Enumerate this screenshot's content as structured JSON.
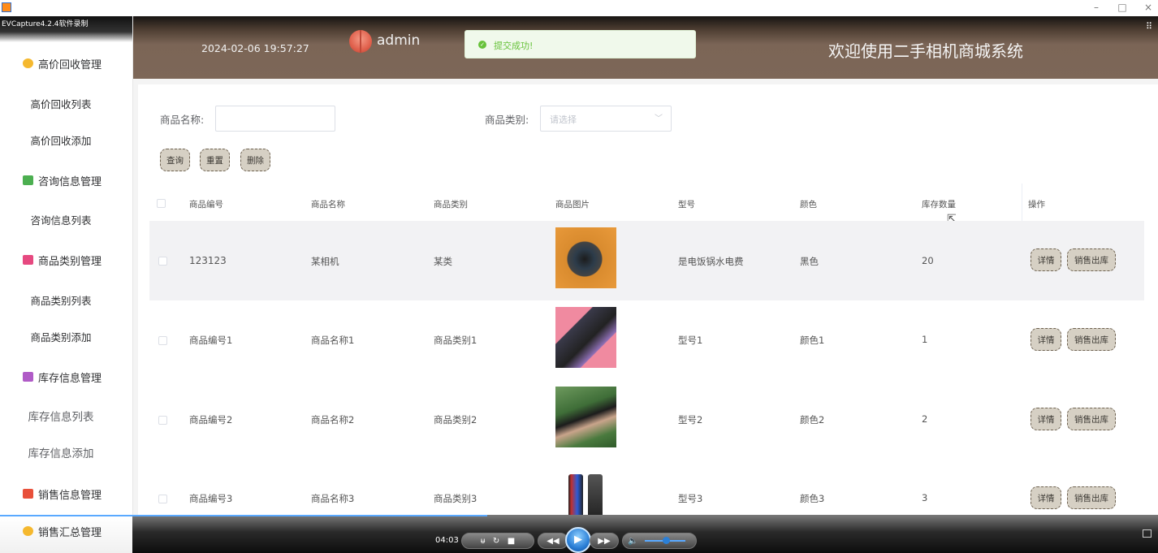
{
  "window": {
    "minimize": "–",
    "maximize": "□",
    "close": "×",
    "recorder_label": "EVCapture4.2.4软件录制"
  },
  "sidebar": {
    "groups": [
      {
        "label": "高价回收管理",
        "icon": "box-icon",
        "color": "#f5b82e",
        "items": [
          "高价回收列表",
          "高价回收添加"
        ]
      },
      {
        "label": "咨询信息管理",
        "icon": "chat-icon",
        "color": "#4caf50",
        "items": [
          "咨询信息列表"
        ]
      },
      {
        "label": "商品类别管理",
        "icon": "category-icon",
        "color": "#e64980",
        "items": [
          "商品类别列表",
          "商品类别添加"
        ]
      },
      {
        "label": "库存信息管理",
        "icon": "inventory-icon",
        "color": "#b05bc7",
        "items": [
          "库存信息列表",
          "库存信息添加"
        ]
      },
      {
        "label": "销售信息管理",
        "icon": "grid-icon",
        "color": "#e8503a",
        "items": []
      },
      {
        "label": "销售汇总管理",
        "icon": "box-icon",
        "color": "#f5b82e",
        "items": []
      }
    ]
  },
  "header": {
    "datetime": "2024-02-06 19:57:27",
    "username": "admin",
    "toast": "提交成功!",
    "title": "欢迎使用二手相机商城系统"
  },
  "search": {
    "name_label": "商品名称:",
    "name_value": "",
    "category_label": "商品类别:",
    "category_placeholder": "请选择",
    "query_button": "查询",
    "reset_button": "重置",
    "delete_button": "删除"
  },
  "table": {
    "headers": [
      "商品编号",
      "商品名称",
      "商品类别",
      "商品图片",
      "型号",
      "颜色",
      "库存数量",
      "操作"
    ],
    "rows": [
      {
        "id": "123123",
        "name": "某相机",
        "category": "某类",
        "image": "camera",
        "model": "是电饭锅水电费",
        "color": "黑色",
        "stock": "20"
      },
      {
        "id": "商品编号1",
        "name": "商品名称1",
        "category": "商品类别1",
        "image": "phone-pink",
        "model": "型号1",
        "color": "颜色1",
        "stock": "1"
      },
      {
        "id": "商品编号2",
        "name": "商品名称2",
        "category": "商品类别2",
        "image": "phone-hand",
        "model": "型号2",
        "color": "颜色2",
        "stock": "2"
      },
      {
        "id": "商品编号3",
        "name": "商品名称3",
        "category": "商品类别3",
        "image": "phones",
        "model": "型号3",
        "color": "颜色3",
        "stock": "3"
      }
    ],
    "detail_button": "详情",
    "sell_button": "销售出库"
  },
  "player": {
    "time": "04:03",
    "progress": 0.42
  }
}
